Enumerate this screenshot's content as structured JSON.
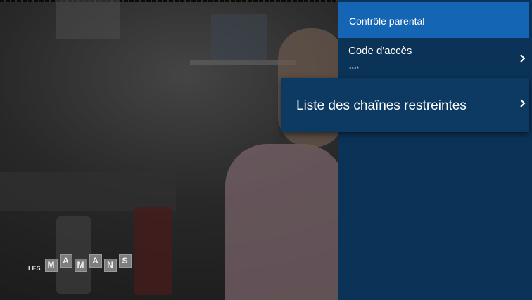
{
  "background": {
    "logo": {
      "prefix": "LES",
      "letters": [
        "M",
        "A",
        "M",
        "A",
        "N",
        "S"
      ]
    }
  },
  "panel": {
    "header_title": "Contrôle parental",
    "items": [
      {
        "label": "Code d'accès",
        "value": "****",
        "icon": "chevron-right-icon"
      },
      {
        "label": "Liste des chaînes restreintes",
        "icon": "chevron-right-icon"
      }
    ]
  },
  "colors": {
    "panel_bg": "#0b3358",
    "header_bg": "#1565b5",
    "focused_item_bg": "#0d3a62",
    "text": "#ffffff"
  }
}
